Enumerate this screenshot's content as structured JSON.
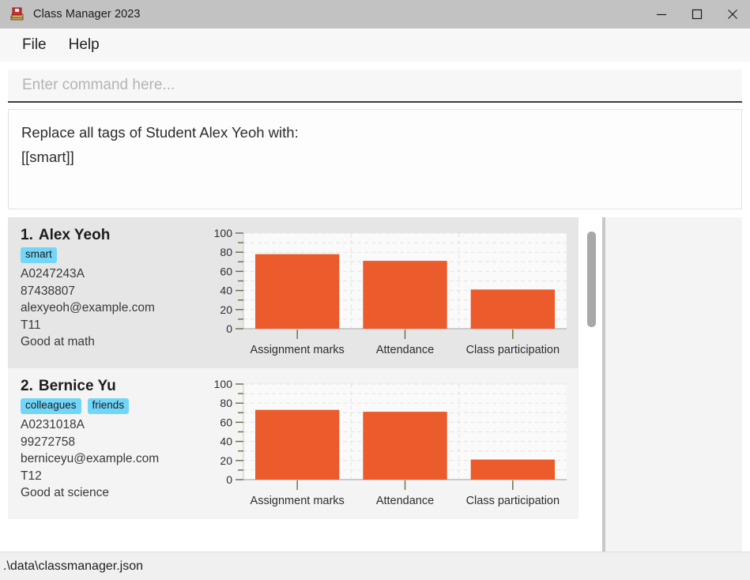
{
  "window": {
    "title": "Class Manager 2023",
    "icon": "books-stack-icon",
    "controls": {
      "minimize": "minimize-icon",
      "maximize": "maximize-icon",
      "close": "close-icon"
    }
  },
  "menu": {
    "items": [
      {
        "label": "File"
      },
      {
        "label": "Help"
      }
    ]
  },
  "command": {
    "value": "",
    "placeholder": "Enter command here..."
  },
  "result": {
    "lines": [
      "Replace all tags of Student Alex Yeoh with:",
      "[[smart]]"
    ]
  },
  "students": [
    {
      "index": "1.",
      "name": "Alex Yeoh",
      "tags": [
        "smart"
      ],
      "id": "A0247243A",
      "phone": "87438807",
      "email": "alexyeoh@example.com",
      "classcode": "T11",
      "remark": "Good at math"
    },
    {
      "index": "2.",
      "name": "Bernice Yu",
      "tags": [
        "colleagues",
        "friends"
      ],
      "id": "A0231018A",
      "phone": "99272758",
      "email": "berniceyu@example.com",
      "classcode": "T12",
      "remark": "Good at science"
    }
  ],
  "status": {
    "file_path": ".\\data\\classmanager.json"
  },
  "colors": {
    "bar": "#eb5b2c",
    "tag": "#71d6f8",
    "titlebar": "#c2c2c2",
    "card_odd": "#e6e6e6",
    "card_even": "#f4f4f4"
  },
  "chart_data": [
    {
      "type": "bar",
      "title": "",
      "xlabel": "",
      "ylabel": "",
      "categories": [
        "Assignment marks",
        "Attendance",
        "Class participation"
      ],
      "values": [
        78,
        71,
        41
      ],
      "ylim": [
        0,
        100
      ],
      "yticks": [
        0,
        20,
        40,
        60,
        80,
        100
      ],
      "yticklabels": [
        "0",
        "20",
        "40",
        "60",
        "80",
        "100"
      ],
      "minor_ytick_step": 10,
      "grid": true,
      "legend": "none",
      "bar_color": "#eb5b2c"
    },
    {
      "type": "bar",
      "title": "",
      "xlabel": "",
      "ylabel": "",
      "categories": [
        "Assignment marks",
        "Attendance",
        "Class participation"
      ],
      "values": [
        73,
        71,
        21
      ],
      "ylim": [
        0,
        100
      ],
      "yticks": [
        0,
        20,
        40,
        60,
        80,
        100
      ],
      "yticklabels": [
        "0",
        "20",
        "40",
        "60",
        "80",
        "100"
      ],
      "minor_ytick_step": 10,
      "grid": true,
      "legend": "none",
      "bar_color": "#eb5b2c"
    }
  ]
}
